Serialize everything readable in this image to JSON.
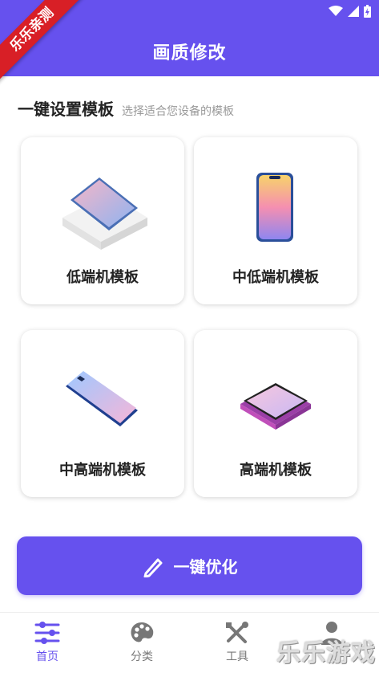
{
  "header": {
    "title": "画质修改",
    "ribbon": "乐乐亲测"
  },
  "section": {
    "title": "一键设置模板",
    "subtitle": "选择适合您设备的模板"
  },
  "templates": [
    {
      "label": "低端机模板"
    },
    {
      "label": "中低端机模板"
    },
    {
      "label": "中高端机模板"
    },
    {
      "label": "高端机模板"
    }
  ],
  "cta": {
    "label": "一键优化",
    "icon": "pen-icon"
  },
  "tabs": [
    {
      "label": "首页",
      "icon": "sliders-icon",
      "active": true
    },
    {
      "label": "分类",
      "icon": "palette-icon",
      "active": false
    },
    {
      "label": "工具",
      "icon": "tools-icon",
      "active": false
    },
    {
      "label": "",
      "icon": "person-icon",
      "active": false
    }
  ],
  "watermark": "乐乐游戏",
  "colors": {
    "accent": "#6651ee",
    "ribbon": "#d81f26"
  }
}
